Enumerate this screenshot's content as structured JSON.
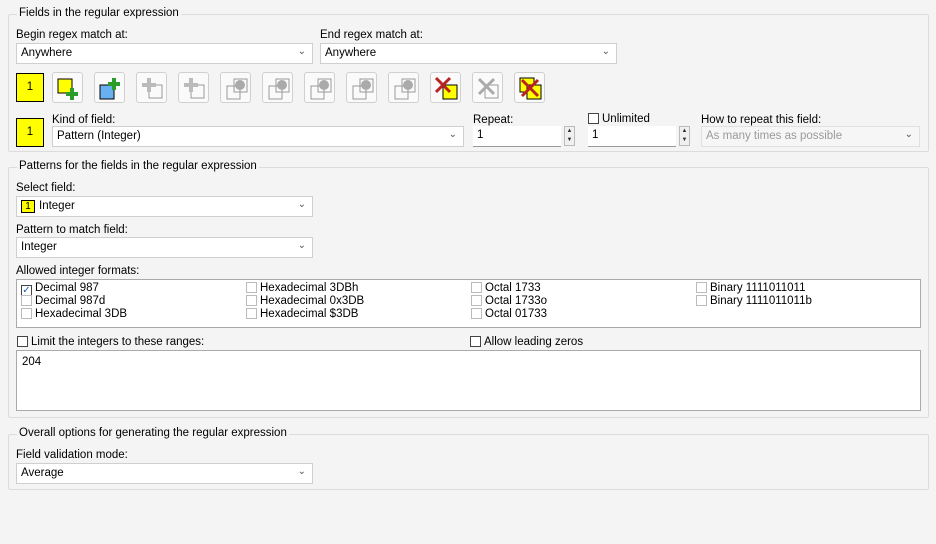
{
  "fields_group": {
    "title": "Fields in the regular expression",
    "begin_label": "Begin regex match at:",
    "begin_value": "Anywhere",
    "end_label": "End regex match at:",
    "end_value": "Anywhere",
    "current_field": "1",
    "toolbar": [
      {
        "name": "add-field-after-button",
        "icon": "add-field-icon",
        "enabled": true
      },
      {
        "name": "add-field-before-button",
        "icon": "insert-field-icon",
        "enabled": true
      },
      {
        "name": "add-subfield-button",
        "icon": "add-subfield-icon",
        "enabled": false
      },
      {
        "name": "add-sibling-button",
        "icon": "add-sibling-icon",
        "enabled": false
      },
      {
        "name": "move-up-button",
        "icon": "arrow-up-icon",
        "enabled": false
      },
      {
        "name": "move-down-button",
        "icon": "arrow-down-icon",
        "enabled": false
      },
      {
        "name": "move-left-button",
        "icon": "arrow-left-icon",
        "enabled": false
      },
      {
        "name": "move-right-button",
        "icon": "arrow-right-icon",
        "enabled": false
      },
      {
        "name": "move-in-button",
        "icon": "arrow-in-icon",
        "enabled": false
      },
      {
        "name": "delete-field-button",
        "icon": "delete-field-icon",
        "enabled": true
      },
      {
        "name": "delete-subfield-button",
        "icon": "delete-icon",
        "enabled": false
      },
      {
        "name": "delete-all-fields-button",
        "icon": "delete-all-icon",
        "enabled": true
      }
    ],
    "field_number": "1",
    "kind_label": "Kind of field:",
    "kind_value": "Pattern (Integer)",
    "repeat_label": "Repeat:",
    "repeat_min": "1",
    "unlimited_label": "Unlimited",
    "repeat_max": "1",
    "how_label": "How to repeat this field:",
    "how_value": "As many times as possible"
  },
  "patterns_group": {
    "title": "Patterns for the fields in the regular expression",
    "select_label": "Select field:",
    "select_num": "1",
    "select_value": "Integer",
    "pattern_label": "Pattern to match field:",
    "pattern_value": "Integer",
    "formats_label": "Allowed integer formats:",
    "formats": [
      [
        {
          "label": "Decimal 987",
          "checked": true
        },
        {
          "label": "Decimal 987d",
          "checked": false
        },
        {
          "label": "Hexadecimal 3DB",
          "checked": false
        }
      ],
      [
        {
          "label": "Hexadecimal 3DBh",
          "checked": false
        },
        {
          "label": "Hexadecimal 0x3DB",
          "checked": false
        },
        {
          "label": "Hexadecimal $3DB",
          "checked": false
        }
      ],
      [
        {
          "label": "Octal 1733",
          "checked": false
        },
        {
          "label": "Octal 1733o",
          "checked": false
        },
        {
          "label": "Octal 01733",
          "checked": false
        }
      ],
      [
        {
          "label": "Binary 1111011011",
          "checked": false
        },
        {
          "label": "Binary 1111011011b",
          "checked": false
        }
      ]
    ],
    "limit_label": "Limit the integers to these ranges:",
    "leading_label": "Allow leading zeros",
    "ranges_value": "204"
  },
  "overall_group": {
    "title": "Overall options for generating the regular expression",
    "mode_label": "Field validation mode:",
    "mode_value": "Average"
  },
  "colors": {
    "field_yellow": "#ffff00"
  }
}
